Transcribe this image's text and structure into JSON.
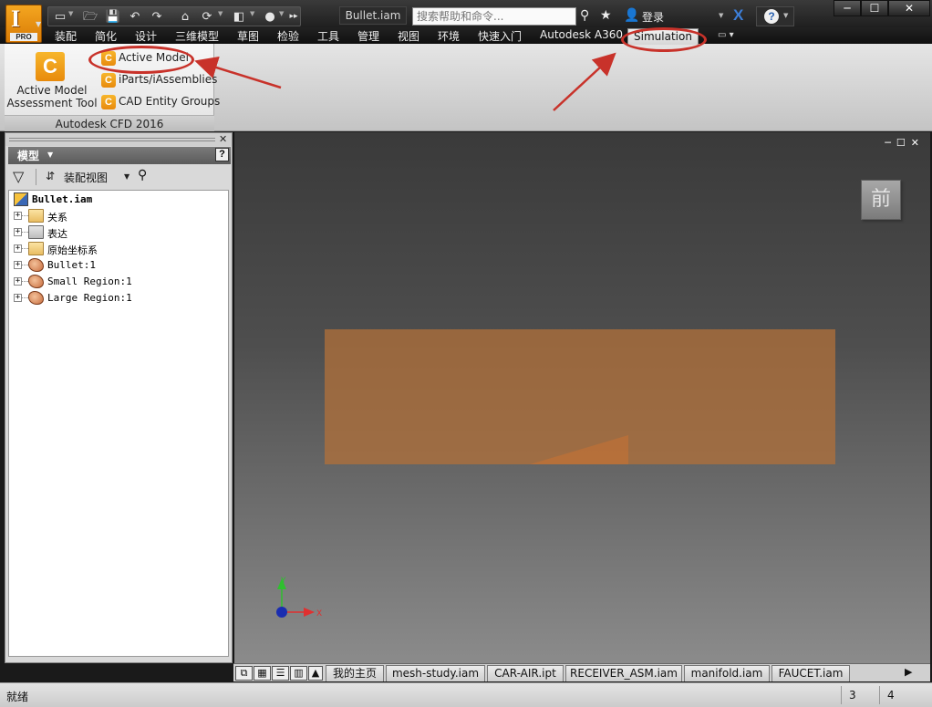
{
  "app": {
    "logo_letter": "I",
    "edition": "PRO",
    "document_title": "Bullet.iam",
    "search_placeholder": "搜索帮助和命令...",
    "login_label": "登录"
  },
  "ribbon_tabs": [
    "装配",
    "简化",
    "设计",
    "三维模型",
    "草图",
    "检验",
    "工具",
    "管理",
    "视图",
    "环境",
    "快速入门",
    "Autodesk A360"
  ],
  "active_tab": "Simulation",
  "ribbon_panel": {
    "title": "Autodesk CFD 2016",
    "big_button_line1": "Active Model",
    "big_button_line2": "Assessment Tool",
    "commands": [
      "Active Model",
      "iParts/iAssemblies",
      "CAD Entity Groups"
    ]
  },
  "browser": {
    "header_title": "模型",
    "view_label": "装配视图",
    "root": "Bullet.iam",
    "nodes": [
      {
        "label": "关系",
        "icon": "folder-icon"
      },
      {
        "label": "表达",
        "icon": "representations-icon"
      },
      {
        "label": "原始坐标系",
        "icon": "folder-icon"
      },
      {
        "label": "Bullet:1",
        "icon": "part-icon"
      },
      {
        "label": "Small Region:1",
        "icon": "part-icon"
      },
      {
        "label": "Large Region:1",
        "icon": "part-icon"
      }
    ]
  },
  "viewport": {
    "viewcube_label": "前",
    "axis_x": "X",
    "axis_y": "Y"
  },
  "doc_tabs": [
    "我的主页",
    "mesh-study.iam",
    "CAR-AIR.ipt",
    "RECEIVER_ASM.iam",
    "manifold.iam",
    "FAUCET.iam"
  ],
  "status": {
    "text": "就绪",
    "cell1": "3",
    "cell2": "4"
  },
  "colors": {
    "annotation_red": "#c8322a",
    "model_orange": "#b2703a",
    "app_orange": "#e88a0c"
  }
}
